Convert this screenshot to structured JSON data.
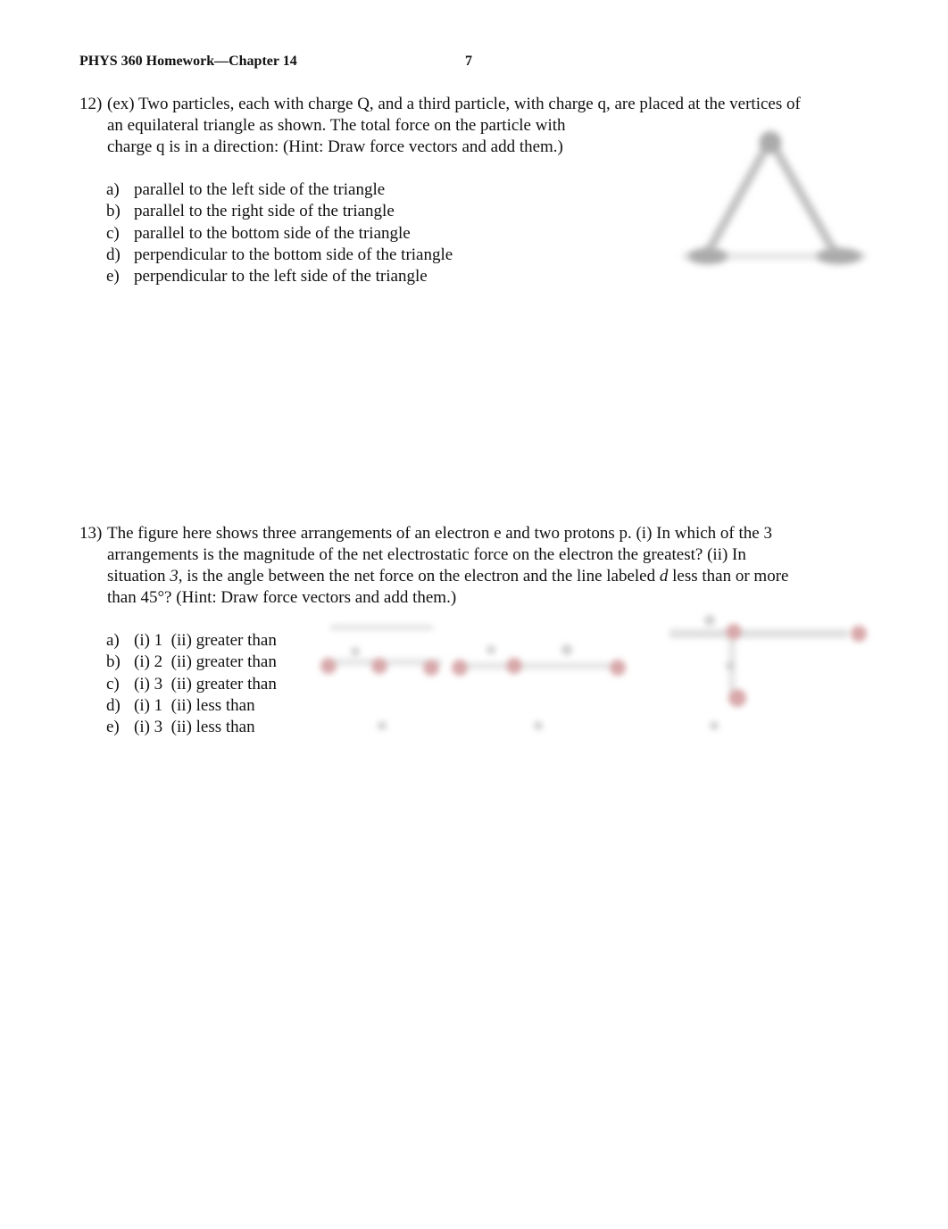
{
  "header": {
    "title": "PHYS 360 Homework—Chapter 14",
    "page_number": "7"
  },
  "questions": [
    {
      "number": "12)",
      "lines": [
        "(ex) Two particles, each with charge Q, and a third particle, with charge q, are placed at the vertices of",
        "an equilateral triangle as shown. The total force on the particle with",
        "charge q is in a direction: (Hint: Draw force vectors and add them.)"
      ],
      "options": [
        {
          "letter": "a)",
          "text": "parallel to the left side of the triangle"
        },
        {
          "letter": "b)",
          "text": "parallel to the right side of the triangle"
        },
        {
          "letter": "c)",
          "text": "parallel to the bottom side of the triangle"
        },
        {
          "letter": "d)",
          "text": "perpendicular to the bottom side of the triangle"
        },
        {
          "letter": "e)",
          "text": "perpendicular to the left side of the triangle"
        }
      ]
    },
    {
      "number": "13)",
      "lines": [
        "The figure here shows three arrangements of an electron e and two protons p. (i) In which of the 3",
        "arrangements is the magnitude of the net electrostatic force on the electron the greatest? (ii) In",
        "situation ",
        "3",
        ", is the angle between the net force on the electron and the line labeled ",
        "d",
        " less than or more",
        "than 45°? (Hint: Draw force vectors and add them.)"
      ],
      "options": [
        {
          "letter": "a)",
          "text": "(i) 1  (ii) greater than"
        },
        {
          "letter": "b)",
          "text": "(i) 2  (ii) greater than"
        },
        {
          "letter": "c)",
          "text": "(i) 3  (ii) greater than"
        },
        {
          "letter": "d)",
          "text": "(i) 1  (ii) less than"
        },
        {
          "letter": "e)",
          "text": "(i) 3  (ii) less than"
        }
      ]
    }
  ]
}
